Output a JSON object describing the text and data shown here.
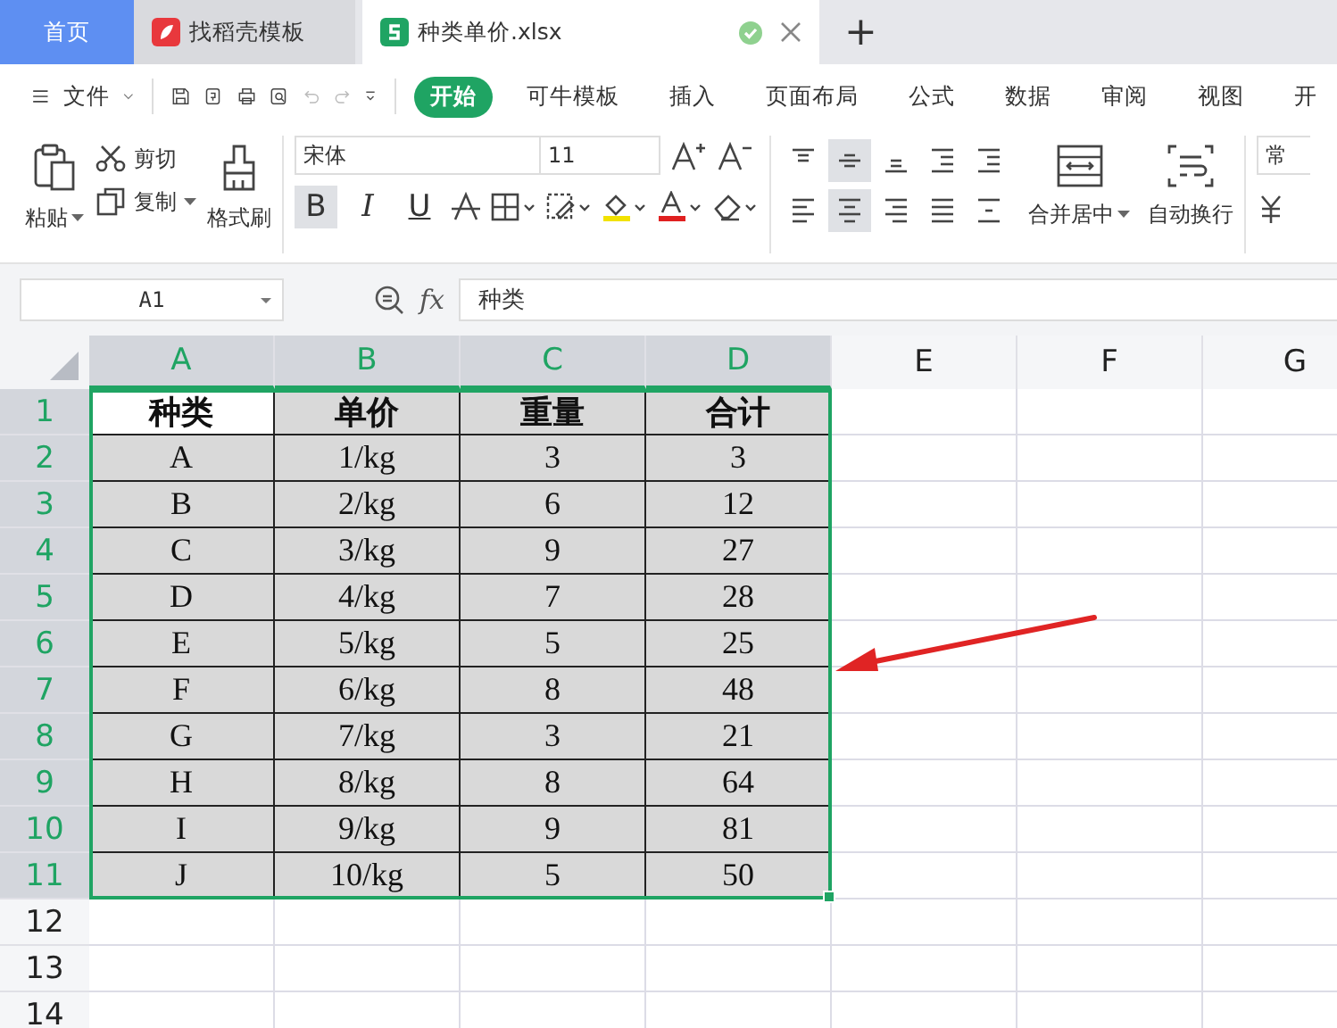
{
  "tabs": [
    {
      "label": "首页",
      "kind": "home",
      "selected": false
    },
    {
      "label": "找稻壳模板",
      "kind": "docer",
      "selected": false
    },
    {
      "label": "种类单价.xlsx",
      "kind": "sheet",
      "selected": true,
      "saved": true
    }
  ],
  "new_tab": "+",
  "menu": {
    "file": "文件",
    "items": [
      {
        "label": "开始",
        "selected": true
      },
      {
        "label": "可牛模板",
        "selected": false
      },
      {
        "label": "插入",
        "selected": false
      },
      {
        "label": "页面布局",
        "selected": false
      },
      {
        "label": "公式",
        "selected": false
      },
      {
        "label": "数据",
        "selected": false
      },
      {
        "label": "审阅",
        "selected": false
      },
      {
        "label": "视图",
        "selected": false
      },
      {
        "label": "开",
        "selected": false
      }
    ]
  },
  "ribbon": {
    "paste": "粘贴",
    "cut": "剪切",
    "copy": "复制",
    "format_painter": "格式刷",
    "font_name": "宋体",
    "font_size": "11",
    "bold": {
      "label": "B",
      "selected": true
    },
    "italic": {
      "label": "I",
      "selected": false
    },
    "underline": {
      "label": "U",
      "selected": false
    },
    "align_buttons": [
      {
        "kind": "top",
        "selected": false
      },
      {
        "kind": "middle",
        "selected": true
      },
      {
        "kind": "bottom",
        "selected": false
      },
      {
        "kind": "outdent",
        "selected": false
      },
      {
        "kind": "indent",
        "selected": false
      },
      {
        "kind": "left",
        "selected": false
      },
      {
        "kind": "center",
        "selected": true
      },
      {
        "kind": "right",
        "selected": false
      },
      {
        "kind": "justify",
        "selected": false
      },
      {
        "kind": "distribute",
        "selected": false
      }
    ],
    "merge": "合并居中",
    "wrap": "自动换行",
    "number_format": "常"
  },
  "formula_bar": {
    "name_box": "A1",
    "fx": "fx",
    "value": "种类"
  },
  "columns": [
    {
      "label": "A",
      "selected": true
    },
    {
      "label": "B",
      "selected": true
    },
    {
      "label": "C",
      "selected": true
    },
    {
      "label": "D",
      "selected": true
    },
    {
      "label": "E",
      "selected": false
    },
    {
      "label": "F",
      "selected": false
    },
    {
      "label": "G",
      "selected": false
    }
  ],
  "rows": [
    {
      "number": "1",
      "selected": true,
      "kind": "header",
      "cells": [
        {
          "text": "种类",
          "active": true
        },
        {
          "text": "单价",
          "active": false
        },
        {
          "text": "重量",
          "active": false
        },
        {
          "text": "合计",
          "active": false
        }
      ]
    },
    {
      "number": "2",
      "selected": true,
      "kind": "data",
      "cells": [
        {
          "text": "A",
          "active": false
        },
        {
          "text": "1/kg",
          "active": false
        },
        {
          "text": "3",
          "active": false
        },
        {
          "text": "3",
          "active": false
        }
      ]
    },
    {
      "number": "3",
      "selected": true,
      "kind": "data",
      "cells": [
        {
          "text": "B",
          "active": false
        },
        {
          "text": "2/kg",
          "active": false
        },
        {
          "text": "6",
          "active": false
        },
        {
          "text": "12",
          "active": false
        }
      ]
    },
    {
      "number": "4",
      "selected": true,
      "kind": "data",
      "cells": [
        {
          "text": "C",
          "active": false
        },
        {
          "text": "3/kg",
          "active": false
        },
        {
          "text": "9",
          "active": false
        },
        {
          "text": "27",
          "active": false
        }
      ]
    },
    {
      "number": "5",
      "selected": true,
      "kind": "data",
      "cells": [
        {
          "text": "D",
          "active": false
        },
        {
          "text": "4/kg",
          "active": false
        },
        {
          "text": "7",
          "active": false
        },
        {
          "text": "28",
          "active": false
        }
      ]
    },
    {
      "number": "6",
      "selected": true,
      "kind": "data",
      "cells": [
        {
          "text": "E",
          "active": false
        },
        {
          "text": "5/kg",
          "active": false
        },
        {
          "text": "5",
          "active": false
        },
        {
          "text": "25",
          "active": false
        }
      ]
    },
    {
      "number": "7",
      "selected": true,
      "kind": "data",
      "cells": [
        {
          "text": "F",
          "active": false
        },
        {
          "text": "6/kg",
          "active": false
        },
        {
          "text": "8",
          "active": false
        },
        {
          "text": "48",
          "active": false
        }
      ]
    },
    {
      "number": "8",
      "selected": true,
      "kind": "data",
      "cells": [
        {
          "text": "G",
          "active": false
        },
        {
          "text": "7/kg",
          "active": false
        },
        {
          "text": "3",
          "active": false
        },
        {
          "text": "21",
          "active": false
        }
      ]
    },
    {
      "number": "9",
      "selected": true,
      "kind": "data",
      "cells": [
        {
          "text": "H",
          "active": false
        },
        {
          "text": "8/kg",
          "active": false
        },
        {
          "text": "8",
          "active": false
        },
        {
          "text": "64",
          "active": false
        }
      ]
    },
    {
      "number": "10",
      "selected": true,
      "kind": "data",
      "cells": [
        {
          "text": "I",
          "active": false
        },
        {
          "text": "9/kg",
          "active": false
        },
        {
          "text": "9",
          "active": false
        },
        {
          "text": "81",
          "active": false
        }
      ]
    },
    {
      "number": "11",
      "selected": true,
      "kind": "data",
      "cells": [
        {
          "text": "J",
          "active": false
        },
        {
          "text": "10/kg",
          "active": false
        },
        {
          "text": "5",
          "active": false
        },
        {
          "text": "50",
          "active": false
        }
      ]
    },
    {
      "number": "12",
      "selected": false,
      "kind": "empty"
    },
    {
      "number": "13",
      "selected": false,
      "kind": "empty"
    },
    {
      "number": "14",
      "selected": false,
      "kind": "empty"
    }
  ]
}
